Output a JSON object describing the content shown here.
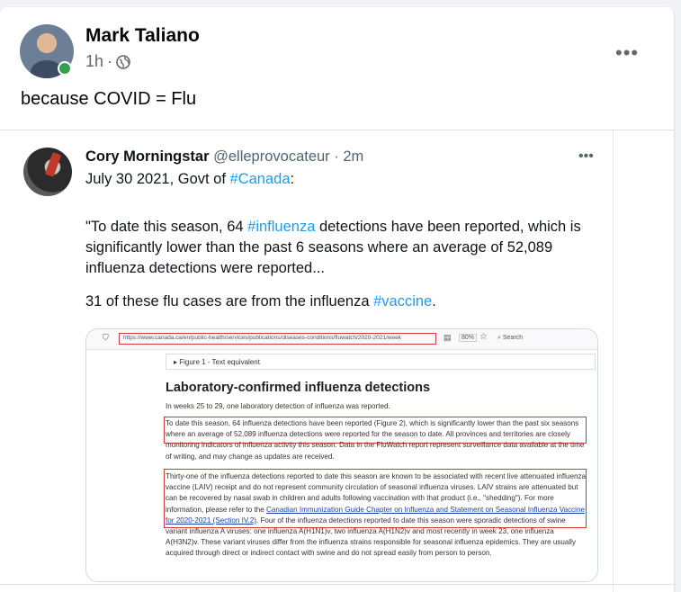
{
  "post": {
    "author": "Mark Taliano",
    "time": "1h",
    "separator": "·",
    "privacy_icon": "globe-icon",
    "more_label": "•••",
    "text": "because COVID = Flu"
  },
  "tweet": {
    "name": "Cory Morningstar",
    "handle": "@elleprovocateur",
    "time": "· 2m",
    "more_label": "•••",
    "line1_pre": "July 30 2021, Govt of ",
    "line1_tag": "#Canada",
    "line1_post": ":",
    "line2_pre": "\"To date this season, 64 ",
    "line2_tag": "#influenza",
    "line2_post": " detections have been reported, which is",
    "line3": "significantly lower than the past 6 seasons where an average of 52,089",
    "line4": "influenza detections were reported...",
    "line5_pre": "31 of these flu cases are from the influenza ",
    "line5_tag": "#vaccine",
    "line5_post": "."
  },
  "screenshot": {
    "url": "https://www.canada.ca/en/public-health/services/publications/diseases-conditions/fluwatch/2020-2021/week",
    "zoom": "80%",
    "search": "Search",
    "figure_label": "▸  Figure 1 - Text equivalent",
    "heading": "Laboratory-confirmed influenza detections",
    "p1": "In weeks 25 to 29, one laboratory detection of influenza was reported.",
    "p2": "To date this season, 64 influenza detections have been reported (Figure 2), which is significantly lower than the past six seasons where an average of 52,089 influenza detections were reported for the season to date. All provinces and territories are closely monitoring indicators of influenza activity this season. Data in the FluWatch report represent surveillance data available at the time of writing, and may change as updates are received.",
    "p3_pre": "Thirty-one of the influenza detections reported to date this season are known to be associated with recent live attenuated influenza vaccine (LAIV) receipt and do not represent community circulation of seasonal influenza viruses. LAIV strains are attenuated but can be recovered by nasal swab in children and adults following vaccination with that product (i.e., \"shedding\"). For more information, please refer to the ",
    "p3_link": "Canadian Immunization Guide Chapter on Influenza and Statement on Seasonal Influenza Vaccine for 2020-2021 (Section IV.2)",
    "p3_post": ". Four of the influenza detections reported to date this season were sporadic detections of swine variant influenza A viruses: one influenza A(H1N1)v, two influenza A(H1N2)v and most recently in week 23, one influenza A(H3N2)v.  These variant viruses differ from the influenza strains responsible for seasonal influenza epidemics. They are usually acquired through direct or indirect contact with swine and do not spread easily from person to person."
  },
  "colors": {
    "accent": "#1d9bf0",
    "highlight_box": "#d23b3b",
    "online": "#31a24c"
  }
}
